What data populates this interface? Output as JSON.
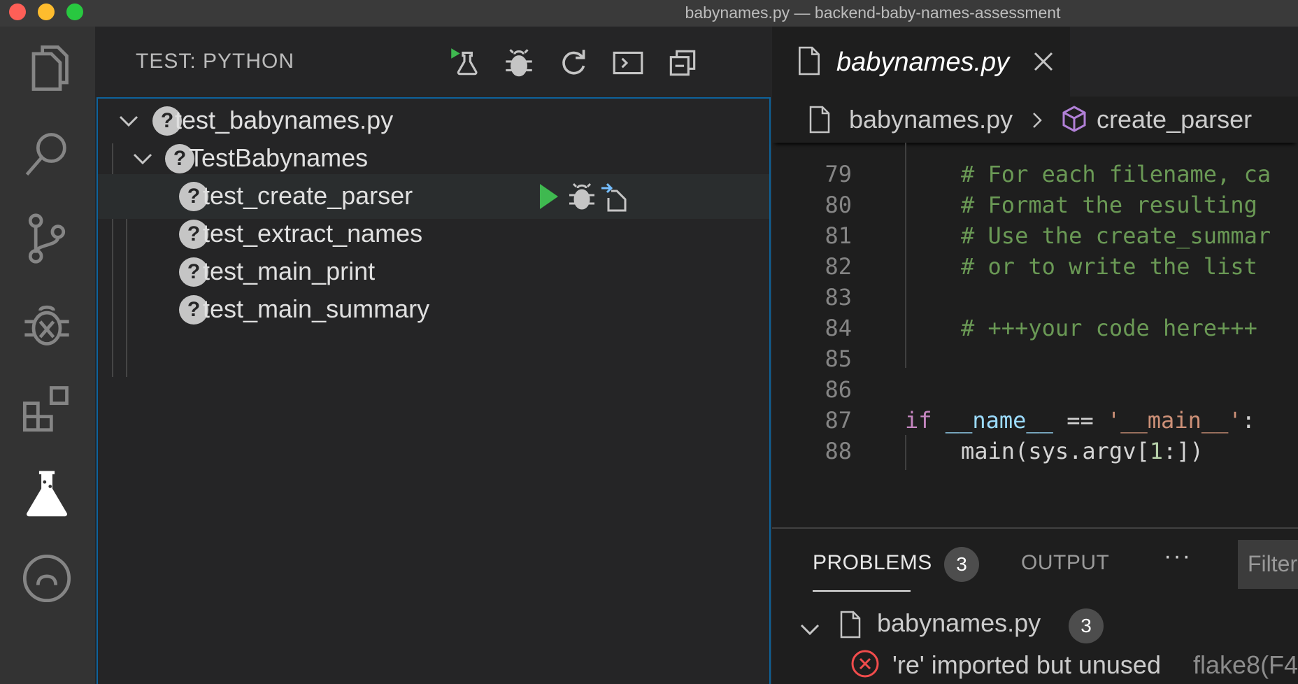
{
  "window": {
    "title": "babynames.py — backend-baby-names-assessment"
  },
  "activity_bar": {
    "items": [
      "explorer-icon",
      "search-icon",
      "source-control-icon",
      "debug-icon",
      "extensions-icon",
      "test-flask-icon",
      "github-icon"
    ]
  },
  "sidebar": {
    "title": "TEST: PYTHON",
    "toolbar": [
      "run-all-tests-icon",
      "debug-all-tests-icon",
      "refresh-icon",
      "terminal-output-icon",
      "collapse-all-icon"
    ],
    "tree": {
      "file": "test_babynames.py",
      "class": "TestBabynames",
      "tests": [
        "test_create_parser",
        "test_extract_names",
        "test_main_print",
        "test_main_summary"
      ],
      "selected_test": "test_create_parser"
    }
  },
  "editor": {
    "tab_label": "babynames.py",
    "breadcrumb": {
      "file": "babynames.py",
      "symbol": "create_parser"
    },
    "lines": [
      {
        "n": "79",
        "text": "    # For each filename, ca"
      },
      {
        "n": "80",
        "text": "    # Format the resulting"
      },
      {
        "n": "81",
        "text": "    # Use the create_summar"
      },
      {
        "n": "82",
        "text": "    # or to write the list"
      },
      {
        "n": "83",
        "text": ""
      },
      {
        "n": "84",
        "text": "    # +++your code here+++"
      },
      {
        "n": "85",
        "text": ""
      },
      {
        "n": "86",
        "text": ""
      },
      {
        "n": "87",
        "text": "if __name__ == '__main__':"
      },
      {
        "n": "88",
        "text": "    main(sys.argv[1:])"
      }
    ],
    "code": {
      "l79": "# For each filename, ca",
      "l80": "# Format the resulting",
      "l81": "# Use the create_summar",
      "l82": "# or to write the list",
      "l84": "# +++your code here+++",
      "l87_kw": "if",
      "l87_var": "__name__",
      "l87_op": "==",
      "l87_str": "'__main__'",
      "l87_colon": ":",
      "l88_fn": "main(sys.argv[",
      "l88_num": "1",
      "l88_end": ":])"
    }
  },
  "panel": {
    "tabs": {
      "problems": "PROBLEMS",
      "problems_count": "3",
      "output": "OUTPUT",
      "more": "···",
      "filter_placeholder": "Filter"
    },
    "group": {
      "file": "babynames.py",
      "count": "3"
    },
    "problem": {
      "message": "'re' imported but unused",
      "source": "flake8(F4"
    }
  },
  "colors": {
    "accent_blue": "#0e639c",
    "run_green": "#3fb950",
    "error_red": "#f14c4c",
    "symbol_purple": "#b180d7"
  }
}
